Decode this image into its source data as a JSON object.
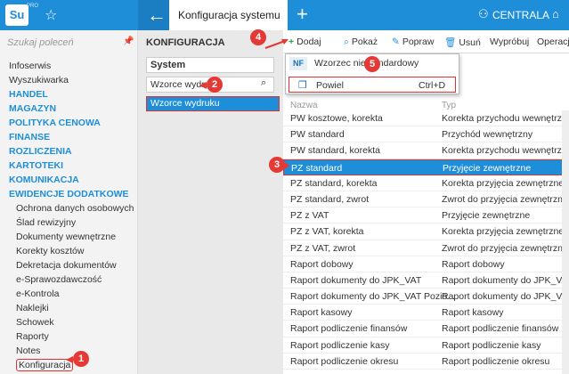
{
  "topbar": {
    "logo": "Su",
    "logo_sup": "PRO",
    "tab_title": "Konfiguracja systemu",
    "branch": "CENTRALA"
  },
  "sidebar": {
    "search_placeholder": "Szukaj poleceń",
    "items": [
      {
        "label": "Infoserwis",
        "type": "item"
      },
      {
        "label": "Wyszukiwarka",
        "type": "item"
      },
      {
        "label": "HANDEL",
        "type": "section"
      },
      {
        "label": "MAGAZYN",
        "type": "section"
      },
      {
        "label": "POLITYKA CENOWA",
        "type": "section"
      },
      {
        "label": "FINANSE",
        "type": "section"
      },
      {
        "label": "ROZLICZENIA",
        "type": "section"
      },
      {
        "label": "KARTOTEKI",
        "type": "section"
      },
      {
        "label": "KOMUNIKACJA",
        "type": "section"
      },
      {
        "label": "EWIDENCJE DODATKOWE",
        "type": "section"
      },
      {
        "label": "Ochrona danych osobowych",
        "type": "sub"
      },
      {
        "label": "Ślad rewizyjny",
        "type": "sub"
      },
      {
        "label": "Dokumenty wewnętrzne",
        "type": "sub"
      },
      {
        "label": "Korekty kosztów",
        "type": "sub"
      },
      {
        "label": "Dekretacja dokumentów",
        "type": "sub"
      },
      {
        "label": "e-Sprawozdawczość",
        "type": "sub"
      },
      {
        "label": "e-Kontrola",
        "type": "sub"
      },
      {
        "label": "Naklejki",
        "type": "sub"
      },
      {
        "label": "Schowek",
        "type": "sub"
      },
      {
        "label": "Raporty",
        "type": "sub"
      },
      {
        "label": "Notes",
        "type": "sub"
      },
      {
        "label": "Konfiguracja",
        "type": "sub-highlight"
      }
    ]
  },
  "mid": {
    "title": "KONFIGURACJA",
    "select_value": "System",
    "input_value": "Wzorce wydru",
    "selected_item": "Wzorce wydruku"
  },
  "toolbar": {
    "add": "Dodaj",
    "show": "Pokaż",
    "edit": "Popraw",
    "delete": "Usuń",
    "test": "Wypróbuj",
    "ops": "Operacje"
  },
  "dropdown": {
    "nf_badge": "NF",
    "item1": "Wzorzec niestandardowy",
    "item2": "Powiel",
    "item2_shortcut": "Ctrl+D"
  },
  "table": {
    "col_name": "Nazwa",
    "col_type": "Typ",
    "rows": [
      {
        "name": "PW kosztowe, korekta",
        "type": "Korekta przychodu wewnętrznego"
      },
      {
        "name": "PW standard",
        "type": "Przychód wewnętrzny"
      },
      {
        "name": "PW standard, korekta",
        "type": "Korekta przychodu wewnętrznego"
      },
      {
        "name": "PZ standard",
        "type": "Przyjęcie zewnętrzne"
      },
      {
        "name": "PZ standard, korekta",
        "type": "Korekta przyjęcia zewnętrznego"
      },
      {
        "name": "PZ standard, zwrot",
        "type": "Zwrot do przyjęcia zewnętrznego"
      },
      {
        "name": "PZ z VAT",
        "type": "Przyjęcie zewnętrzne"
      },
      {
        "name": "PZ z VAT, korekta",
        "type": "Korekta przyjęcia zewnętrznego"
      },
      {
        "name": "PZ z VAT, zwrot",
        "type": "Zwrot do przyjęcia zewnętrznego"
      },
      {
        "name": "Raport dobowy",
        "type": "Raport dobowy"
      },
      {
        "name": "Raport dokumenty do JPK_VAT",
        "type": "Raport dokumenty do JPK_VAT"
      },
      {
        "name": "Raport dokumenty do JPK_VAT Pozio...",
        "type": "Raport dokumenty do JPK_VAT"
      },
      {
        "name": "Raport kasowy",
        "type": "Raport kasowy"
      },
      {
        "name": "Raport podliczenie finansów",
        "type": "Raport podliczenie finansów"
      },
      {
        "name": "Raport podliczenie kasy",
        "type": "Raport podliczenie kasy"
      },
      {
        "name": "Raport podliczenie okresu",
        "type": "Raport podliczenie okresu"
      }
    ],
    "selected_index": 3
  },
  "callouts": [
    "1",
    "2",
    "3",
    "4",
    "5"
  ],
  "colors": {
    "accent": "#1f8ed8",
    "callout": "#e53935",
    "highlight_border": "#dd3333"
  }
}
